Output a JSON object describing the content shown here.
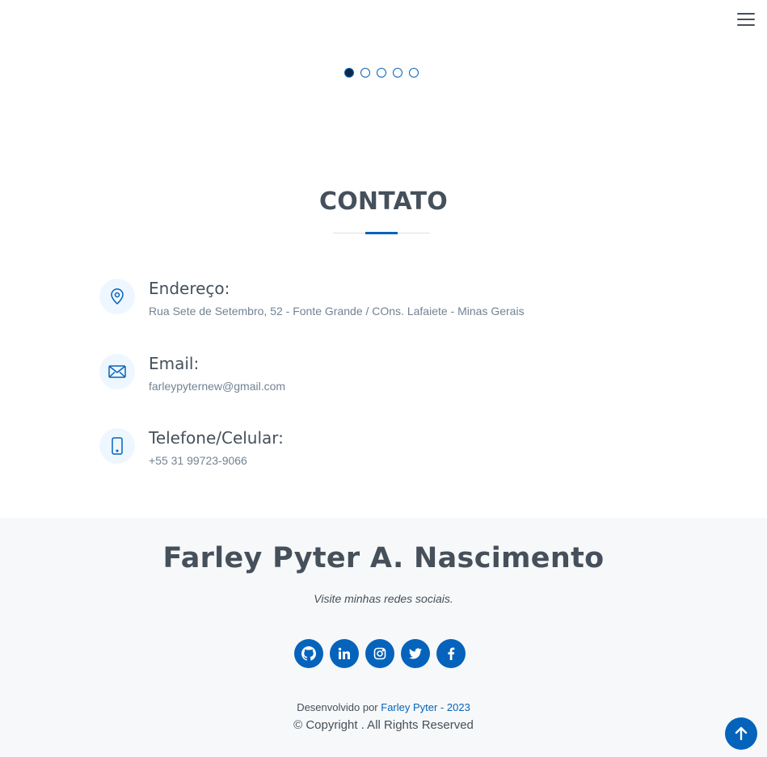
{
  "carousel": {
    "slide_count": 5,
    "active_index": 0
  },
  "contact": {
    "title": "CONTATO",
    "items": [
      {
        "label": "Endereço:",
        "value": "Rua Sete de Setembro, 52 - Fonte Grande / COns. Lafaiete - Minas Gerais",
        "icon": "map-pin-icon"
      },
      {
        "label": "Email:",
        "value": "farleypyternew@gmail.com",
        "icon": "envelope-icon"
      },
      {
        "label": "Telefone/Celular:",
        "value": "+55 31 99723-9066",
        "icon": "phone-icon"
      }
    ]
  },
  "footer": {
    "name": "Farley Pyter A. Nascimento",
    "tagline": "Visite minhas redes sociais.",
    "social": [
      "github-icon",
      "linkedin-icon",
      "instagram-icon",
      "twitter-icon",
      "facebook-icon"
    ],
    "credits_prefix": "Desenvolvido por ",
    "credits_link": "Farley Pyter - 2023",
    "copyright": "© Copyright . All Rights Reserved"
  },
  "colors": {
    "accent": "#0563bb",
    "text": "#45505b",
    "muted": "#728394",
    "footer_bg": "#f7f8f9",
    "icon_bg": "#eef7ff"
  }
}
